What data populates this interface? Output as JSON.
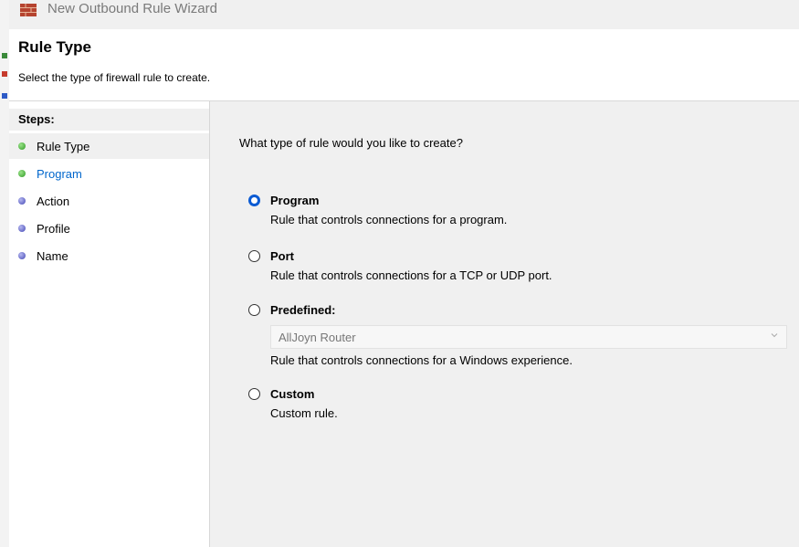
{
  "window": {
    "title": "New Outbound Rule Wizard"
  },
  "header": {
    "title": "Rule Type",
    "subtitle": "Select the type of firewall rule to create."
  },
  "steps": {
    "heading": "Steps:",
    "items": [
      {
        "label": "Rule Type",
        "state": "current",
        "dot": "green"
      },
      {
        "label": "Program",
        "state": "link",
        "dot": "green"
      },
      {
        "label": "Action",
        "state": "pending",
        "dot": "blue"
      },
      {
        "label": "Profile",
        "state": "pending",
        "dot": "blue"
      },
      {
        "label": "Name",
        "state": "pending",
        "dot": "blue"
      }
    ]
  },
  "main": {
    "question": "What type of rule would you like to create?",
    "options": [
      {
        "label": "Program",
        "description": "Rule that controls connections for a program.",
        "selected": true
      },
      {
        "label": "Port",
        "description": "Rule that controls connections for a TCP or UDP port.",
        "selected": false
      },
      {
        "label": "Predefined:",
        "description": "Rule that controls connections for a Windows experience.",
        "selected": false
      },
      {
        "label": "Custom",
        "description": "Custom rule.",
        "selected": false
      }
    ],
    "predefined_dropdown": {
      "value": "AllJoyn Router",
      "disabled": true
    }
  },
  "colors": {
    "accent": "#0b5bd3",
    "step_link": "#0066cc",
    "panel_bg": "#f0f0f0"
  },
  "icons": {
    "app": "firewall-icon",
    "dropdown": "chevron-down-icon"
  }
}
